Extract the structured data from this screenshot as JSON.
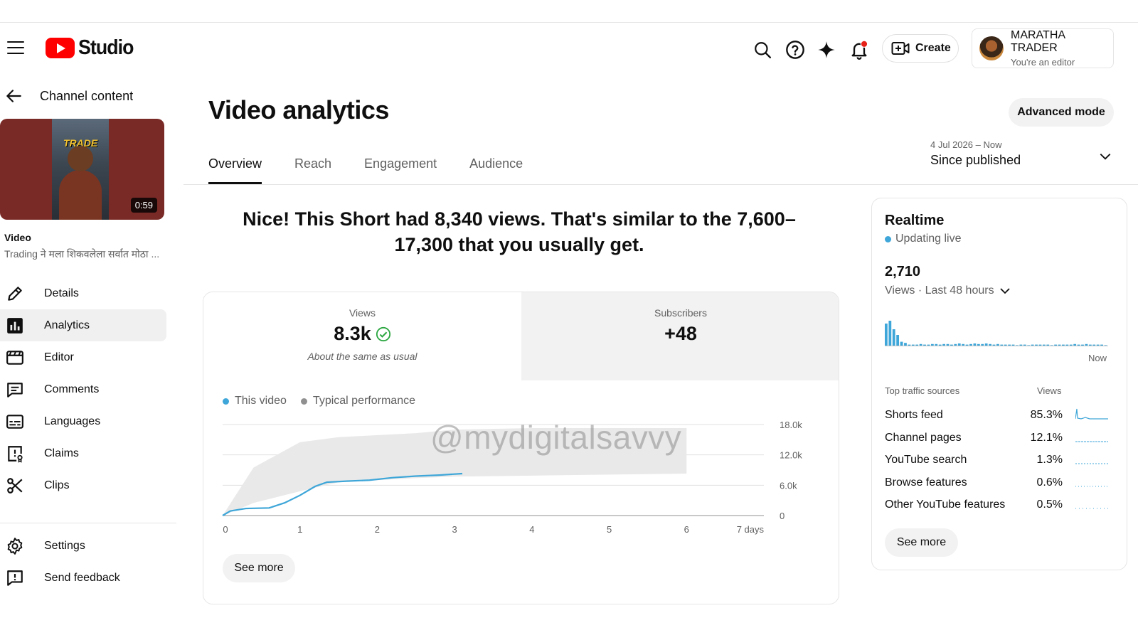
{
  "header": {
    "logo_text": "Studio",
    "create_label": "Create",
    "account_name": "MARATHA TRADER",
    "account_role": "You're an editor"
  },
  "sidebar": {
    "back_label": "Channel content",
    "thumbnail_text": "TRADE",
    "duration": "0:59",
    "video_label": "Video",
    "video_title": "Trading ने मला शिकवलेला सर्वात मोठा ...",
    "items": [
      {
        "label": "Details",
        "icon": "pencil-icon"
      },
      {
        "label": "Analytics",
        "icon": "analytics-icon",
        "active": true
      },
      {
        "label": "Editor",
        "icon": "editor-icon"
      },
      {
        "label": "Comments",
        "icon": "comments-icon"
      },
      {
        "label": "Languages",
        "icon": "languages-icon"
      },
      {
        "label": "Claims",
        "icon": "claims-icon"
      },
      {
        "label": "Clips",
        "icon": "scissors-icon"
      }
    ],
    "bottom_items": [
      {
        "label": "Settings",
        "icon": "gear-icon"
      },
      {
        "label": "Send feedback",
        "icon": "feedback-icon"
      }
    ]
  },
  "main": {
    "title": "Video analytics",
    "advanced_mode_label": "Advanced mode",
    "tabs": [
      {
        "label": "Overview",
        "active": true
      },
      {
        "label": "Reach"
      },
      {
        "label": "Engagement"
      },
      {
        "label": "Audience"
      }
    ],
    "date_range": "4 Jul 2026 – Now",
    "date_label": "Since published",
    "headline": "Nice! This Short had 8,340 views. That's similar to the 7,600–17,300 that you usually get.",
    "metrics": {
      "views_label": "Views",
      "views_value": "8.3k",
      "views_sub": "About the same as usual",
      "subs_label": "Subscribers",
      "subs_value": "+48"
    },
    "legend": {
      "this_video": "This video",
      "typical": "Typical performance"
    },
    "see_more_label": "See more",
    "watermark": "@mydigitalsavvy"
  },
  "chart_data": {
    "type": "line",
    "x_ticks": [
      "0",
      "1",
      "2",
      "3",
      "4",
      "5",
      "6",
      "7 days"
    ],
    "y_ticks": [
      "18.0k",
      "12.0k",
      "6.0k",
      "0"
    ],
    "ylim": [
      0,
      18000
    ],
    "xlim": [
      0,
      7
    ],
    "series": [
      {
        "name": "This video",
        "color": "#3ea6d8",
        "x": [
          0,
          0.1,
          0.3,
          0.6,
          0.8,
          1.0,
          1.2,
          1.35,
          1.6,
          1.9,
          2.2,
          2.5,
          2.8,
          3.1
        ],
        "y": [
          0,
          900,
          1400,
          1500,
          2500,
          4000,
          5800,
          6600,
          6800,
          7000,
          7500,
          7800,
          8000,
          8300
        ]
      }
    ],
    "band": {
      "name": "Typical performance",
      "color": "#e9e9e9",
      "x": [
        0,
        0.4,
        1.0,
        1.5,
        2.5,
        3.0,
        4.0,
        5.0,
        6.0
      ],
      "upper": [
        0,
        9500,
        14500,
        15500,
        16300,
        17000,
        17300,
        17300,
        17300
      ],
      "lower": [
        0,
        2500,
        4800,
        6600,
        7400,
        7700,
        7900,
        8100,
        8300
      ]
    }
  },
  "realtime": {
    "title": "Realtime",
    "live_label": "Updating live",
    "count": "2,710",
    "period_label": "Views · Last 48 hours",
    "now_label": "Now",
    "spark_values": [
      40,
      45,
      30,
      20,
      8,
      6,
      3,
      3,
      3,
      4,
      3,
      3,
      4,
      4,
      3,
      4,
      4,
      3,
      4,
      5,
      4,
      3,
      4,
      5,
      4,
      4,
      5,
      4,
      3,
      4,
      3,
      3,
      3,
      3,
      2,
      3,
      3,
      2,
      3,
      3,
      3,
      3,
      3,
      2,
      3,
      3,
      3,
      3,
      3,
      4,
      3,
      3,
      4,
      3,
      3,
      3,
      3,
      2
    ],
    "sources_header": "Top traffic sources",
    "views_header": "Views",
    "sources": [
      {
        "name": "Shorts feed",
        "pct": "85.3%"
      },
      {
        "name": "Channel pages",
        "pct": "12.1%"
      },
      {
        "name": "YouTube search",
        "pct": "1.3%"
      },
      {
        "name": "Browse features",
        "pct": "0.6%"
      },
      {
        "name": "Other YouTube features",
        "pct": "0.5%"
      }
    ],
    "see_more_label": "See more"
  }
}
